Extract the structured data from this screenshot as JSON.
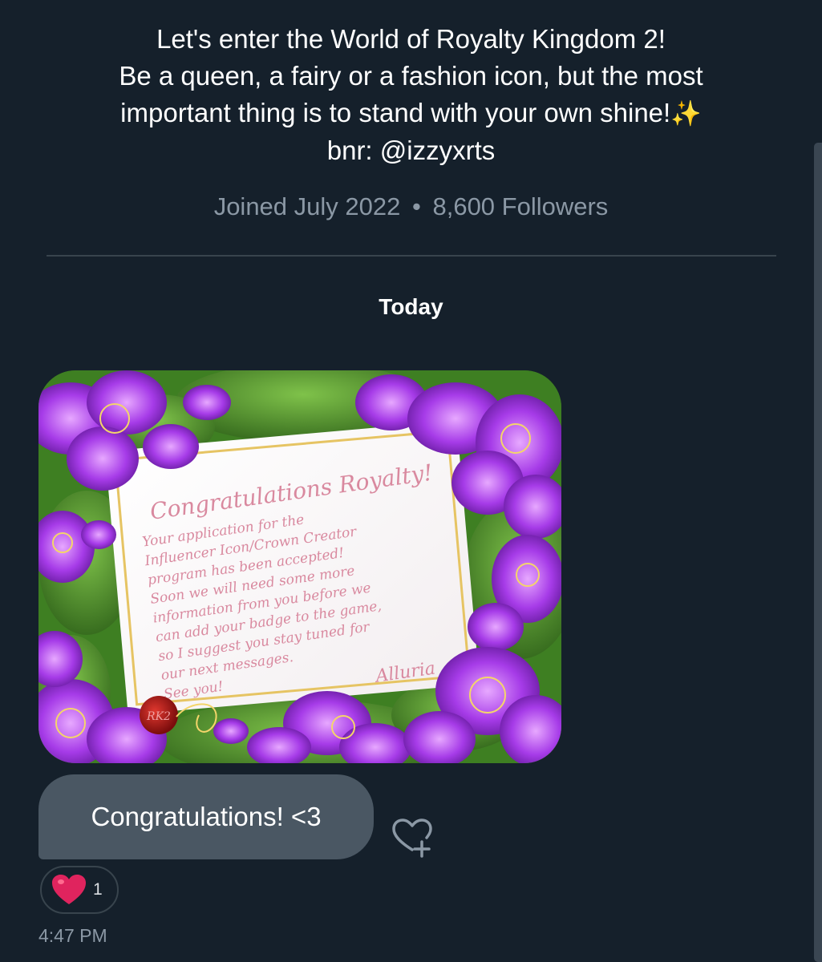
{
  "profile": {
    "bio_lines": [
      "Let's enter the World of Royalty Kingdom 2!",
      "Be a queen, a fairy or a fashion icon, but the most",
      "important thing is to stand with your own shine!",
      "bnr: @izzyxrts"
    ],
    "bio_emoji": "✨",
    "joined": "Joined July 2022",
    "separator": "•",
    "followers": "8,600 Followers"
  },
  "conversation": {
    "day_label": "Today",
    "image_card": {
      "heading": "Congratulations Royalty!",
      "body_lines": [
        "Your application for the",
        "Influencer Icon/Crown Creator",
        "program has been accepted!",
        "Soon we will need some more",
        "information from you before we",
        "can add your badge to the game,",
        "so I suggest you stay tuned for",
        "our next messages.",
        "See you!"
      ],
      "signature": "Alluria",
      "seal_text": "RK2"
    },
    "message": {
      "text": "Congratulations! <3",
      "reaction_emoji": "heart-icon",
      "reaction_count": "1",
      "time": "4:47 PM"
    }
  },
  "colors": {
    "background": "#15202b",
    "bubble": "#4a5763",
    "muted_text": "#8b98a5",
    "divider": "#38444d",
    "heart": "#e0245e"
  }
}
